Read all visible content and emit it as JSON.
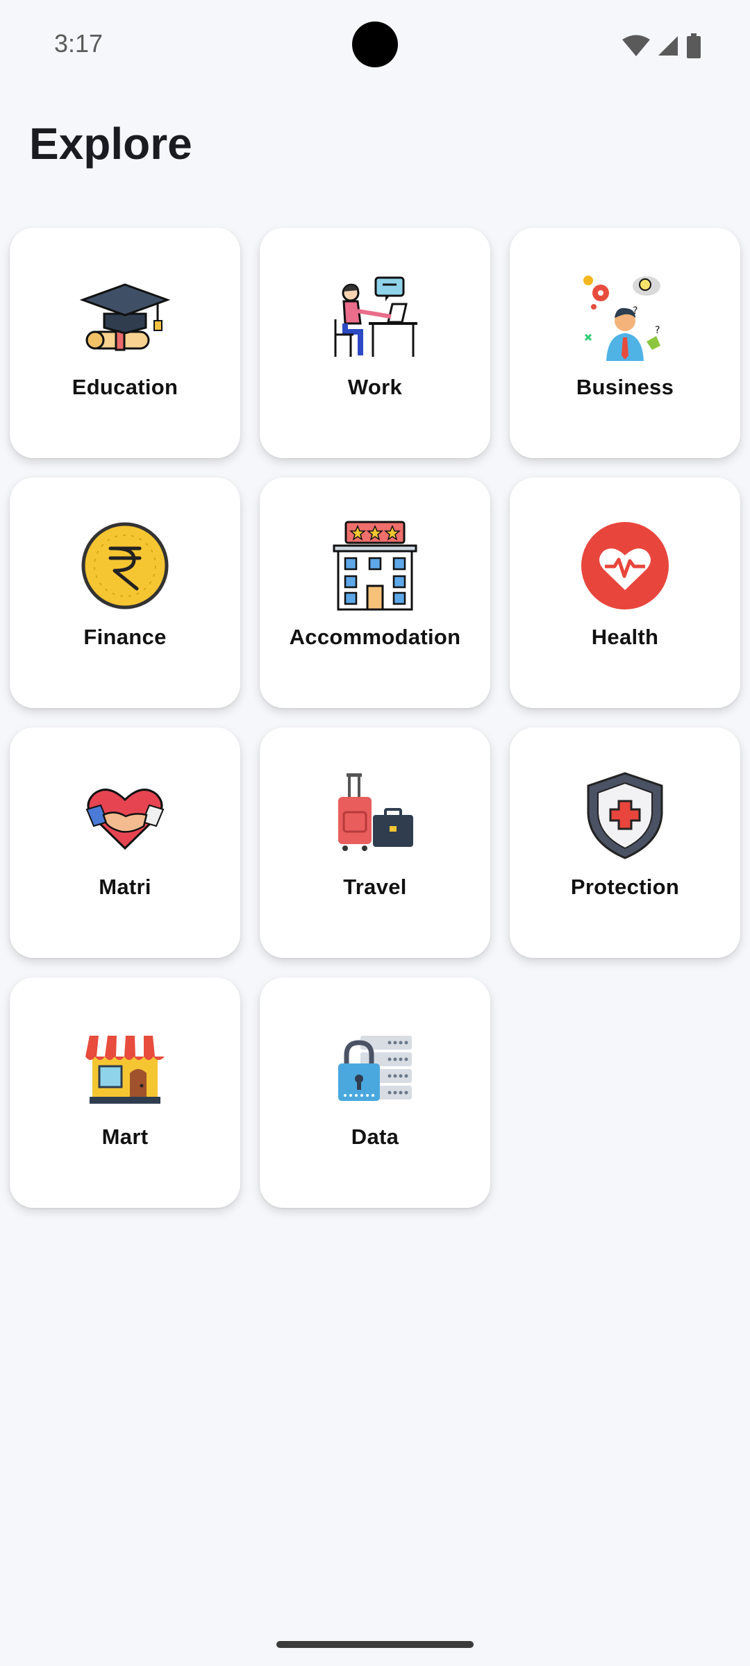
{
  "status_bar": {
    "time": "3:17",
    "icons": [
      "wifi-icon",
      "cellular-signal-icon",
      "battery-icon"
    ]
  },
  "page": {
    "title": "Explore"
  },
  "categories": [
    {
      "label": "Education",
      "icon": "graduation-cap-icon"
    },
    {
      "label": "Work",
      "icon": "person-at-desk-icon"
    },
    {
      "label": "Business",
      "icon": "businessman-ideas-icon"
    },
    {
      "label": "Finance",
      "icon": "rupee-coin-icon"
    },
    {
      "label": "Accommodation",
      "icon": "hotel-building-icon"
    },
    {
      "label": "Health",
      "icon": "heart-pulse-icon"
    },
    {
      "label": "Matri",
      "icon": "heart-handshake-icon"
    },
    {
      "label": "Travel",
      "icon": "luggage-icon"
    },
    {
      "label": "Protection",
      "icon": "shield-cross-icon"
    },
    {
      "label": "Mart",
      "icon": "store-front-icon"
    },
    {
      "label": "Data",
      "icon": "secure-database-icon"
    }
  ],
  "colors": {
    "background": "#f6f7fb",
    "card": "#ffffff",
    "text": "#111111"
  }
}
